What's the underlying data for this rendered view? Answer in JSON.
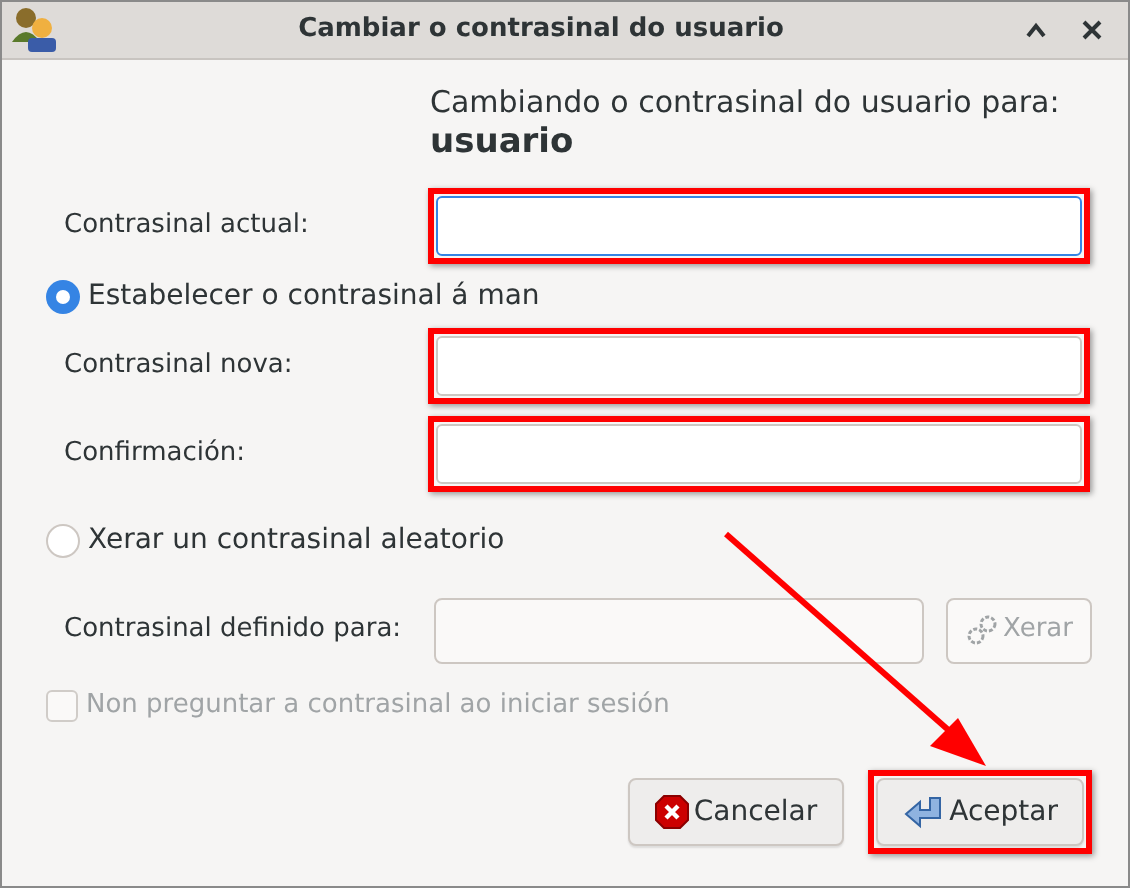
{
  "window": {
    "title": "Cambiar o contrasinal do usuario"
  },
  "heading": {
    "text": "Cambiando o contrasinal do usuario para:",
    "user": "usuario"
  },
  "current": {
    "label": "Contrasinal actual:",
    "focused": true,
    "highlighted": true
  },
  "modes": [
    {
      "label": "Estabelecer o contrasinal á man",
      "selected": true,
      "fields": [
        {
          "label": "Contrasinal nova:",
          "highlighted": true
        },
        {
          "label": "Confirmación:",
          "highlighted": true
        }
      ]
    },
    {
      "label": "Xerar un contrasinal aleatorio",
      "selected": false,
      "generated": {
        "label": "Contrasinal definido para:",
        "button": "Xerar",
        "disabled": true
      }
    }
  ],
  "no_ask": {
    "label": "Non preguntar a contrasinal ao iniciar sesión",
    "checked": false,
    "disabled": true
  },
  "buttons": [
    {
      "kind": "cancel",
      "label": "Cancelar",
      "highlighted": false
    },
    {
      "kind": "ok",
      "label": "Aceptar",
      "highlighted": true
    }
  ],
  "annotations": [
    {
      "kind": "arrow"
    }
  ]
}
